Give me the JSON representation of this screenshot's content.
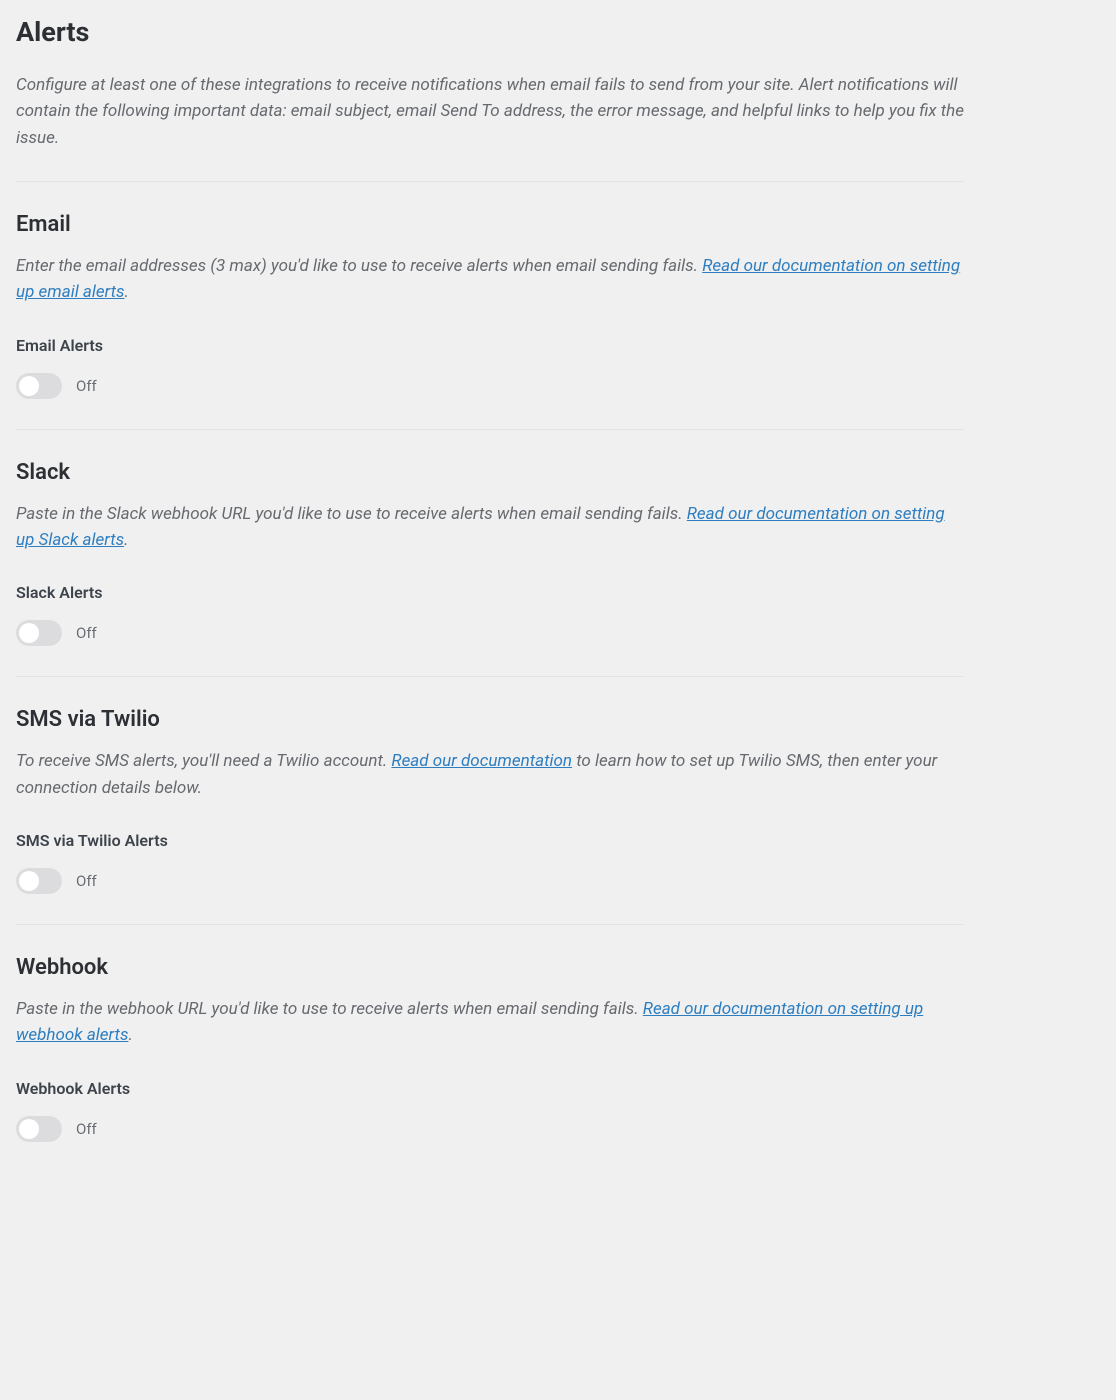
{
  "page": {
    "title": "Alerts",
    "intro": "Configure at least one of these integrations to receive notifications when email fails to send from your site. Alert notifications will contain the following important data: email subject, email Send To address, the error message, and helpful links to help you fix the issue."
  },
  "sections": {
    "email": {
      "title": "Email",
      "desc_prefix": "Enter the email addresses (3 max) you'd like to use to receive alerts when email sending fails. ",
      "link_text": "Read our documentation on setting up email alerts",
      "desc_suffix": ".",
      "toggle_label": "Email Alerts",
      "toggle_state": "Off"
    },
    "slack": {
      "title": "Slack",
      "desc_prefix": "Paste in the Slack webhook URL you'd like to use to receive alerts when email sending fails. ",
      "link_text": "Read our documentation on setting up Slack alerts",
      "desc_suffix": ".",
      "toggle_label": "Slack Alerts",
      "toggle_state": "Off"
    },
    "sms": {
      "title": "SMS via Twilio",
      "desc_prefix": "To receive SMS alerts, you'll need a Twilio account. ",
      "link_text": "Read our documentation",
      "desc_suffix": " to learn how to set up Twilio SMS, then enter your connection details below.",
      "toggle_label": "SMS via Twilio Alerts",
      "toggle_state": "Off"
    },
    "webhook": {
      "title": "Webhook",
      "desc_prefix": "Paste in the webhook URL you'd like to use to receive alerts when email sending fails. ",
      "link_text": "Read our documentation on setting up webhook alerts",
      "desc_suffix": ".",
      "toggle_label": "Webhook Alerts",
      "toggle_state": "Off"
    }
  }
}
